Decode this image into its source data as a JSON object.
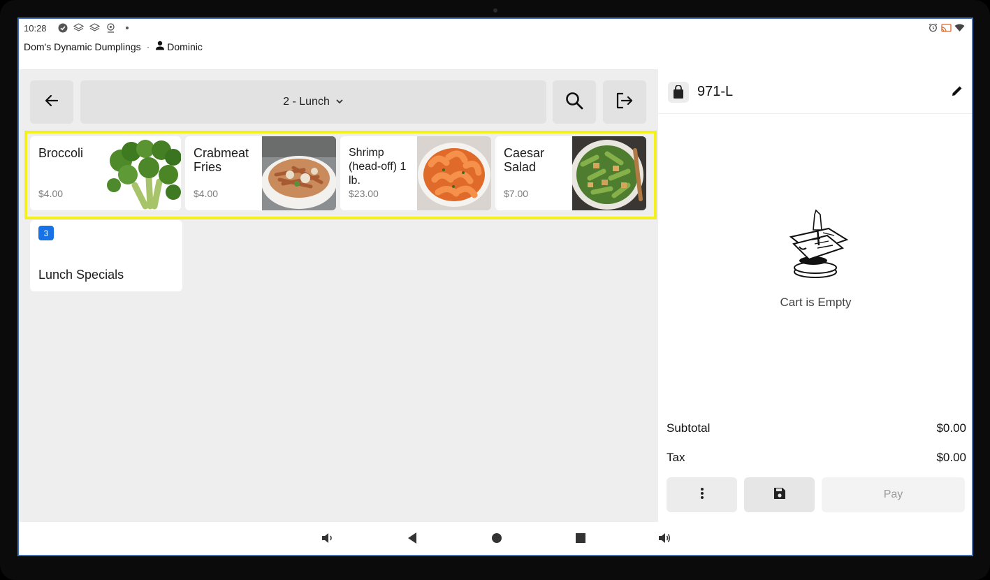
{
  "status_bar": {
    "time": "10:28",
    "left_icons": [
      "check-circle-icon",
      "layers-icon",
      "layers-icon",
      "location-icon",
      "dot-icon"
    ],
    "right_icons": [
      "alarm-icon",
      "cast-icon",
      "wifi-icon"
    ]
  },
  "app": {
    "store_name": "Dom's Dynamic Dumplings",
    "separator": "·",
    "user_name": "Dominic"
  },
  "toolbar": {
    "category_label": "2 - Lunch"
  },
  "menu_items": [
    {
      "name": "Broccoli",
      "price": "$4.00",
      "image": "broccoli-image"
    },
    {
      "name": "Crabmeat Fries",
      "price": "$4.00",
      "image": "crabmeat-fries-image"
    },
    {
      "name": "Shrimp (head-off) 1 lb.",
      "price": "$23.00",
      "image": "shrimp-image"
    },
    {
      "name": "Caesar Salad",
      "price": "$7.00",
      "image": "caesar-salad-image"
    }
  ],
  "category_tiles": [
    {
      "badge": "3",
      "label": "Lunch Specials"
    }
  ],
  "order": {
    "id": "971-L",
    "empty_text": "Cart is Empty",
    "subtotal_label": "Subtotal",
    "subtotal_value": "$0.00",
    "tax_label": "Tax",
    "tax_value": "$0.00",
    "pay_label": "Pay"
  },
  "colors": {
    "highlight": "#f4ef1e",
    "badge": "#1672e6",
    "panel_bg": "#eeeeee"
  }
}
